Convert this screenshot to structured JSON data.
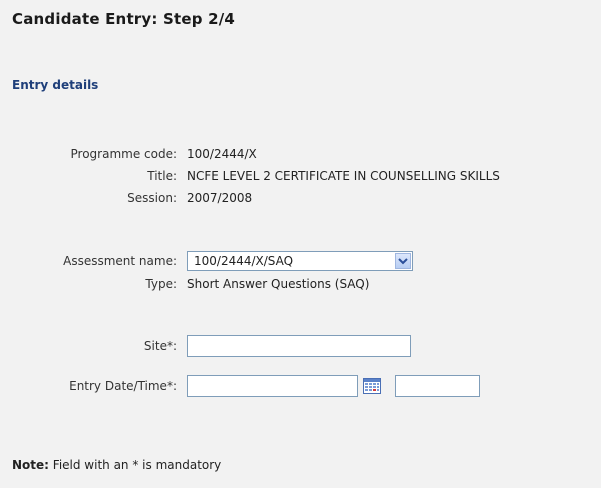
{
  "page": {
    "title": "Candidate Entry: Step 2/4",
    "section_title": "Entry details"
  },
  "details": {
    "programme_code_label": "Programme code:",
    "programme_code_value": "100/2444/X",
    "title_label": "Title:",
    "title_value": "NCFE LEVEL 2 CERTIFICATE IN COUNSELLING SKILLS",
    "session_label": "Session:",
    "session_value": "2007/2008"
  },
  "assessment": {
    "label": "Assessment name:",
    "selected": "100/2444/X/SAQ",
    "type_label": "Type:",
    "type_value": "Short Answer Questions (SAQ)"
  },
  "form": {
    "site_label": "Site*:",
    "site_value": "",
    "entry_datetime_label": "Entry Date/Time*:",
    "date_value": "",
    "time_value": ""
  },
  "note": {
    "prefix": "Note:",
    "text": "Field with an * is mandatory"
  },
  "icons": {
    "dropdown": "chevron-down-icon",
    "calendar": "calendar-icon"
  },
  "colors": {
    "panel_background": "#f2f2f2",
    "section_title": "#1f3f7a",
    "input_border": "#7f9db9"
  }
}
